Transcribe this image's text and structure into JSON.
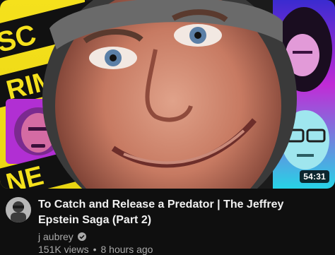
{
  "video": {
    "duration": "54:31",
    "title": "To Catch and Release a Predator | The Jeffrey Epstein Saga (Part 2)",
    "channel_name": "j aubrey",
    "views": "151K views",
    "separator": "•",
    "age": "8 hours ago"
  },
  "thumbnail": {
    "left_text_top": "SC",
    "left_text_mid": "RIM",
    "left_text_bottom": "NE",
    "accent_yellow": "#f5e11c",
    "accent_magenta": "#c12bd6",
    "accent_cyan": "#27d3e6"
  },
  "icons": {
    "verified": "verified-check-icon"
  }
}
